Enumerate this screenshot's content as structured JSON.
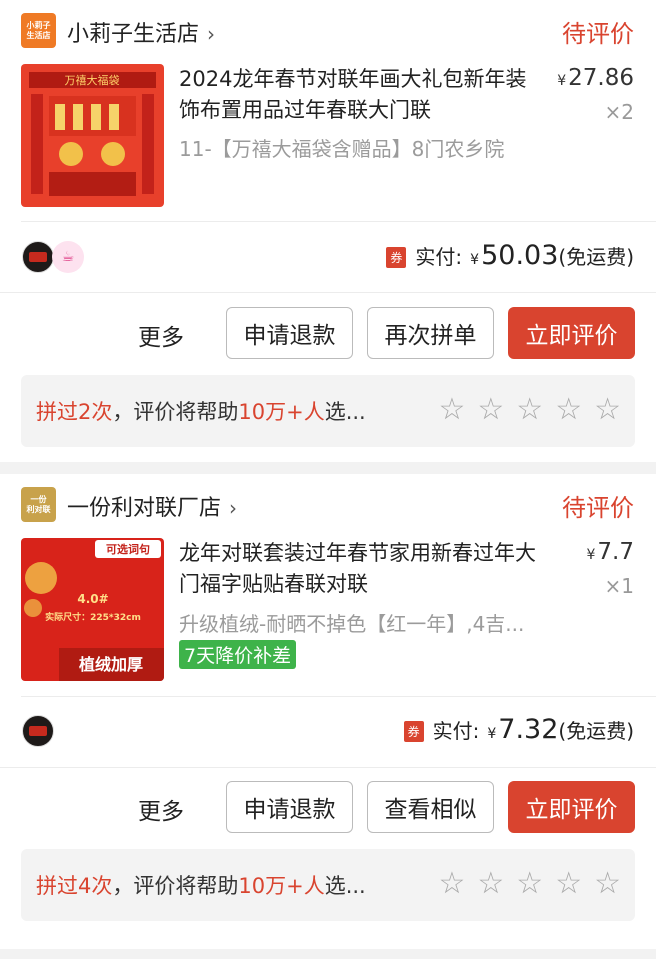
{
  "orders": [
    {
      "shop": {
        "name": "小莉子生活店",
        "logo_text": "小莉子生活店",
        "logo_color": "#ef7a25"
      },
      "status": "待评价",
      "product": {
        "title": "2024龙年春节对联年画大礼包新年装饰布置用品过年春联大门联",
        "price": "27.86",
        "qty": "×2",
        "spec": "11-【万禧大福袋含赠品】8门农乡院",
        "image_label": "万禧大福袋"
      },
      "paid": {
        "coupon": "券",
        "label": "实付:",
        "currency": "¥",
        "amount": "50.03",
        "shipping": "(免运费)"
      },
      "buttons": {
        "more": "更多",
        "refund": "申请退款",
        "second": "再次拼单",
        "review": "立即评价"
      },
      "review_bar": {
        "prefix": "拼过2次",
        "middle": "，评价将帮助",
        "highlight": "10万+人",
        "suffix": "选..."
      },
      "stars": [
        "☆",
        "☆",
        "☆",
        "☆",
        "☆"
      ]
    },
    {
      "shop": {
        "name": "一份利对联厂店",
        "logo_text": "一份利对联",
        "logo_color": "#c8a24b"
      },
      "status": "待评价",
      "product": {
        "title": "龙年对联套装过年春节家用新春过年大门福字贴贴春联对联",
        "price": "7.7",
        "qty": "×1",
        "spec": "升级植绒-耐晒不掉色【红一年】,4吉...",
        "tag": "7天降价补差",
        "image_badge": "可选词句",
        "image_size_line1": "4.0#",
        "image_size_line2": "实际尺寸：225*32cm",
        "image_caption": "植绒加厚"
      },
      "paid": {
        "coupon": "券",
        "label": "实付:",
        "currency": "¥",
        "amount": "7.32",
        "shipping": "(免运费)"
      },
      "buttons": {
        "more": "更多",
        "refund": "申请退款",
        "second": "查看相似",
        "review": "立即评价"
      },
      "review_bar": {
        "prefix": "拼过4次",
        "middle": "，评价将帮助",
        "highlight": "10万+人",
        "suffix": "选..."
      },
      "stars": [
        "☆",
        "☆",
        "☆",
        "☆",
        "☆"
      ]
    }
  ],
  "colors": {
    "accent": "#d9442f",
    "green_tag": "#3eb34a"
  }
}
